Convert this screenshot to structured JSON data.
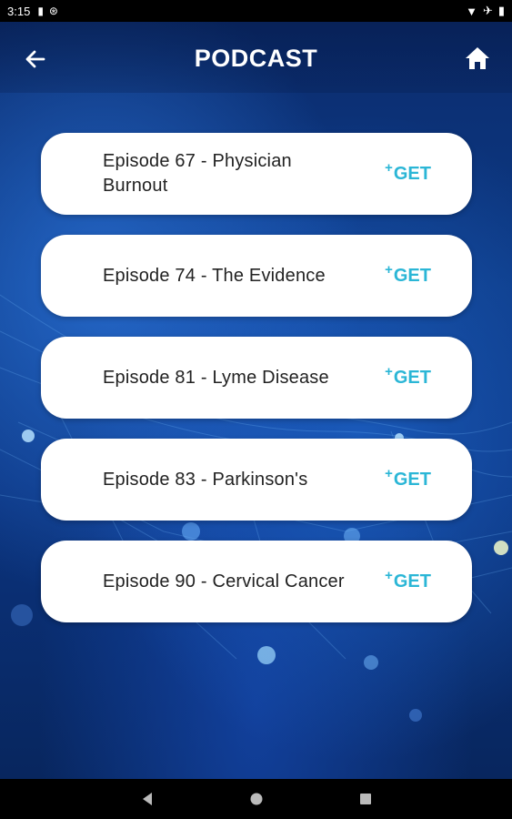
{
  "status_bar": {
    "time": "3:15",
    "icons": [
      "sd-card-icon",
      "sync-icon",
      "wifi-icon",
      "airplane-icon",
      "battery-icon"
    ]
  },
  "header": {
    "title": "PODCAST",
    "back_icon": "arrow-left-icon",
    "home_icon": "home-icon"
  },
  "episodes": [
    {
      "title": "Episode 67 - Physician Burnout",
      "action": "GET",
      "action_prefix": "+"
    },
    {
      "title": "Episode 74 - The Evidence",
      "action": "GET",
      "action_prefix": "+"
    },
    {
      "title": "Episode 81 - Lyme Disease",
      "action": "GET",
      "action_prefix": "+"
    },
    {
      "title": "Episode 83 - Parkinson's",
      "action": "GET",
      "action_prefix": "+"
    },
    {
      "title": "Episode 90 - Cervical Cancer",
      "action": "GET",
      "action_prefix": "+"
    }
  ],
  "colors": {
    "accent": "#2bb6d6",
    "background": "#0b3480",
    "card": "#ffffff"
  },
  "nav_bar": {
    "icons": [
      "back-triangle-icon",
      "home-circle-icon",
      "recents-square-icon"
    ]
  }
}
